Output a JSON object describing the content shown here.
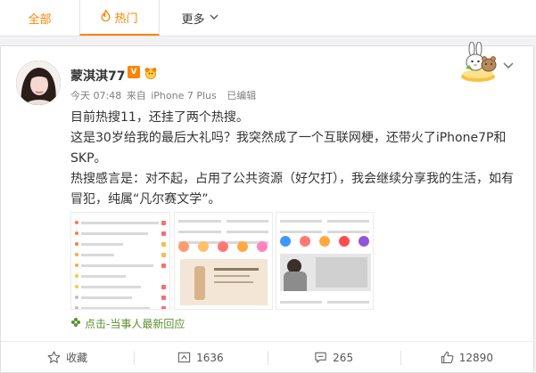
{
  "tabs": [
    {
      "label": "全部"
    },
    {
      "label": "热门"
    },
    {
      "label": "更多"
    }
  ],
  "post": {
    "username": "蒙淇淇77",
    "vbadge": "V",
    "meta": {
      "time": "今天 07:48",
      "source_prefix": "来自",
      "source": "iPhone 7 Plus",
      "edited": "已编辑"
    },
    "paragraphs": [
      "目前热搜11，还挂了两个热搜。",
      "这是30岁给我的最后大礼吗？我突然成了一个互联网梗，还带火了iPhone7P和SKP。",
      "热搜感言是：对不起，占用了公共资源（好欠打），我会继续分享我的生活，如有冒犯，纯属“凡尔赛文学”。"
    ],
    "action_link": "点击-当事人最新回应"
  },
  "footer": {
    "favorite": "收藏",
    "repost": "1636",
    "comment": "265",
    "like": "12890"
  },
  "colors": {
    "accent": "#ff8200",
    "action_green": "#5a8f2f",
    "meta_gray": "#808080"
  }
}
